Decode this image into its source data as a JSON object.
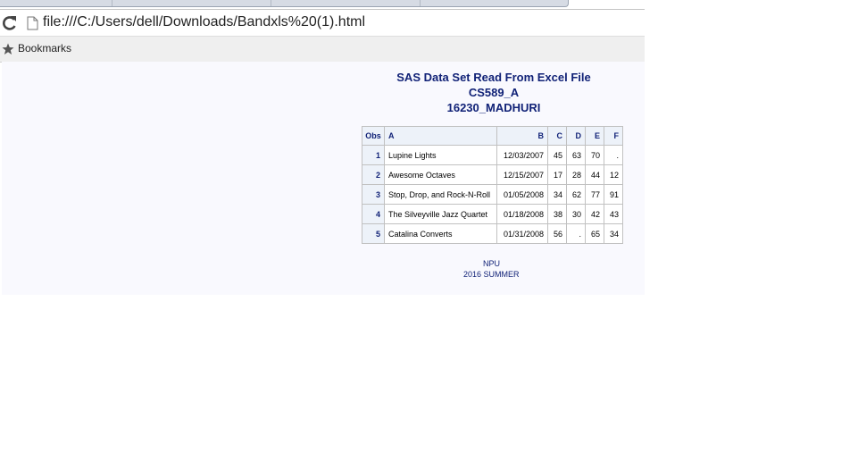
{
  "browser": {
    "url": "file:///C:/Users/dell/Downloads/Bandxls%20(1).html",
    "bookmarks_label": "Bookmarks"
  },
  "page": {
    "titles": [
      "SAS Data Set Read From Excel File",
      "CS589_A",
      "16230_MADHURI"
    ],
    "table": {
      "headers": [
        "Obs",
        "A",
        "B",
        "C",
        "D",
        "E",
        "F"
      ],
      "rows": [
        [
          "1",
          "Lupine Lights",
          "12/03/2007",
          "45",
          "63",
          "70",
          "."
        ],
        [
          "2",
          "Awesome Octaves",
          "12/15/2007",
          "17",
          "28",
          "44",
          "12"
        ],
        [
          "3",
          "Stop, Drop, and Rock-N-Roll",
          "01/05/2008",
          "34",
          "62",
          "77",
          "91"
        ],
        [
          "4",
          "The Silveyville Jazz Quartet",
          "01/18/2008",
          "38",
          "30",
          "42",
          "43"
        ],
        [
          "5",
          "Catalina Converts",
          "01/31/2008",
          "56",
          ".",
          "65",
          "34"
        ]
      ]
    },
    "footnotes": [
      "NPU",
      "2016 SUMMER"
    ]
  }
}
